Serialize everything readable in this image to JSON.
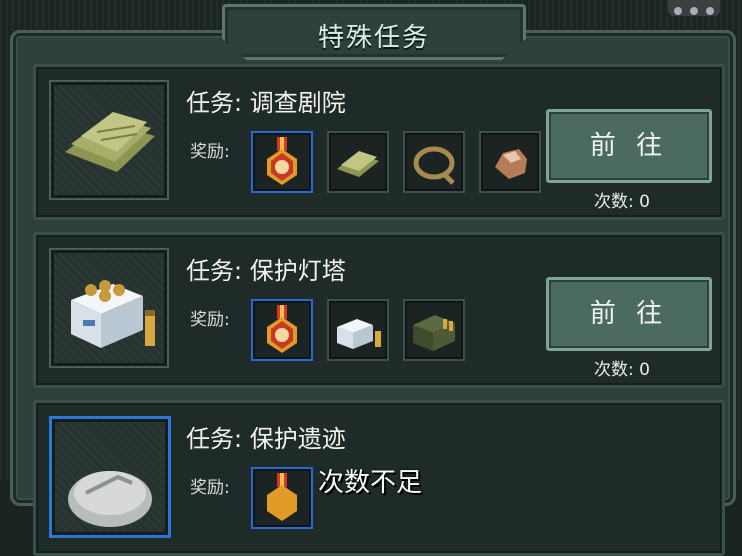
{
  "header": {
    "title": "特殊任务"
  },
  "missions": [
    {
      "title": "任务: 调查剧院",
      "reward_label": "奖励:",
      "button_label": "前 往",
      "count_label": "次数: 0",
      "thumb_icon": "document-scroll-icon",
      "rewards": [
        "medal-icon",
        "document-icon",
        "rope-icon",
        "ore-rock-icon"
      ]
    },
    {
      "title": "任务: 保护灯塔",
      "reward_label": "奖励:",
      "button_label": "前 往",
      "count_label": "次数: 0",
      "thumb_icon": "ammo-crate-icon",
      "rewards": [
        "medal-icon",
        "ammo-crate-icon",
        "ammo-box-icon"
      ]
    },
    {
      "title": "任务: 保护遗迹",
      "reward_label": "奖励:",
      "thumb_icon": "stone-relic-icon",
      "rewards": [
        "medal-icon"
      ]
    }
  ],
  "overlay_text": "次数不足",
  "colors": {
    "accent_blue": "#2d78d6",
    "button_green": "#4b6a60",
    "panel": "#2f3f3b"
  }
}
